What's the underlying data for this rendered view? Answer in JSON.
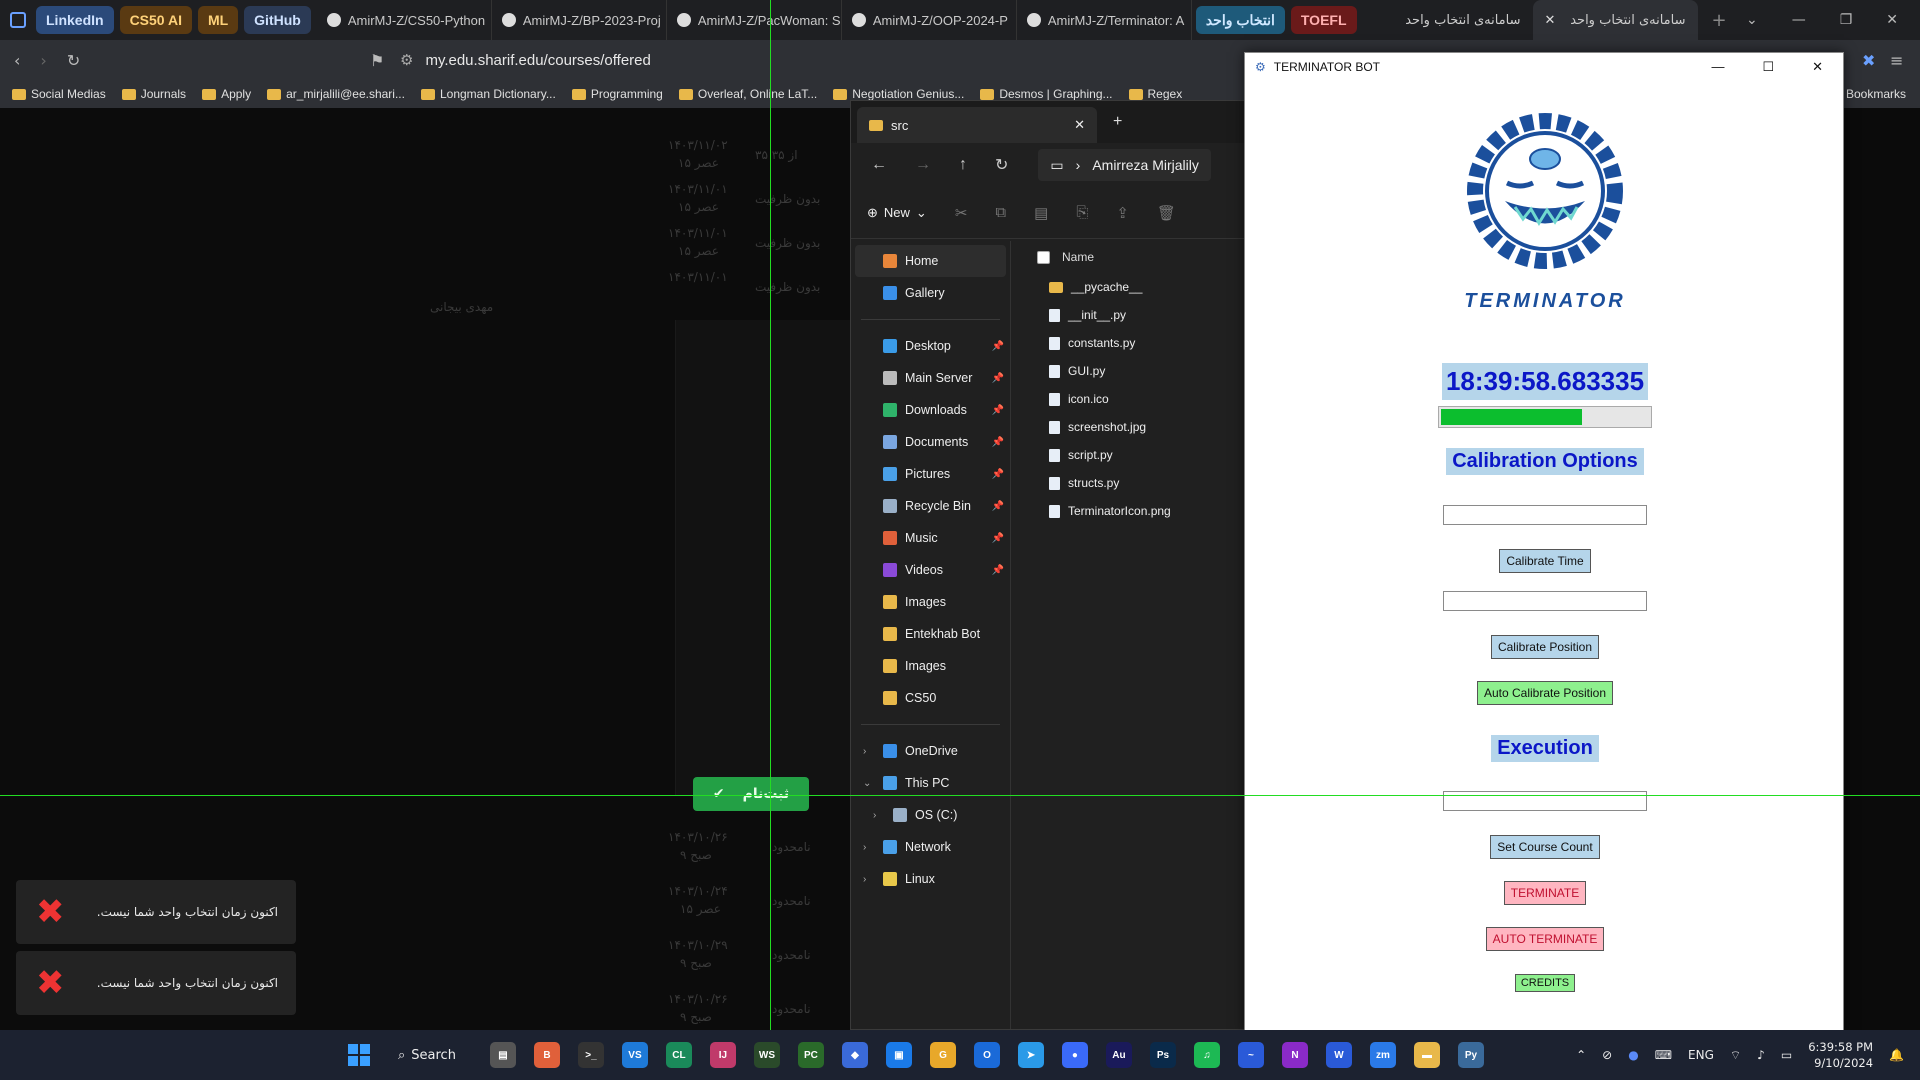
{
  "browser": {
    "pills": [
      {
        "label": "LinkedIn",
        "bg": "#2b4a7a",
        "fg": "#cfe2ff"
      },
      {
        "label": "CS50 AI",
        "bg": "#5a3a12",
        "fg": "#ffd27a"
      },
      {
        "label": "ML",
        "bg": "#5a3a12",
        "fg": "#ffd27a"
      },
      {
        "label": "GitHub",
        "bg": "#2b3a55",
        "fg": "#cfe2ff"
      }
    ],
    "gh_tabs": [
      "AmirMJ-Z/CS50-Python",
      "AmirMJ-Z/BP-2023-Proj",
      "AmirMJ-Z/PacWoman: S",
      "AmirMJ-Z/OOP-2024-P",
      "AmirMJ-Z/Terminator: A"
    ],
    "pill_select": "انتخاب واحد",
    "pill_toefl": "TOEFL",
    "tab_inactive": "سامانه‌ی انتخاب واحد",
    "tab_active": "سامانه‌ی انتخاب واحد",
    "url": "my.edu.sharif.edu/courses/offered",
    "bookmarks": [
      "Social Medias",
      "Journals",
      "Apply",
      "ar_mirjalili@ee.shari...",
      "Longman Dictionary...",
      "Programming",
      "Overleaf, Online LaT...",
      "Negotiation Genius...",
      "Desmos | Graphing...",
      "Regex"
    ],
    "all_bookmarks": "Bookmarks"
  },
  "page": {
    "rows": [
      {
        "date": "۱۴۰۳/۱۱/۰۲",
        "time": "۱۵ عصر",
        "cap": "۳۵ از ۳۵"
      },
      {
        "date": "۱۴۰۳/۱۱/۰۱",
        "time": "۱۵ عصر",
        "cap": "بدون ظرفیت"
      },
      {
        "date": "۱۴۰۳/۱۱/۰۱",
        "time": "۱۵ عصر",
        "cap": "بدون ظرفیت"
      },
      {
        "date": "۱۴۰۳/۱۱/۰۱",
        "time": "",
        "cap": "بدون ظرفیت"
      }
    ],
    "teacher": "مهدی بیجانی",
    "lower_rows": [
      {
        "date": "۱۴۰۳/۱۰/۲۶",
        "time": "۹ صبح",
        "cap": "نامحدود"
      },
      {
        "date": "۱۴۰۳/۱۰/۲۴",
        "time": "۱۵ عصر",
        "cap": "نامحدود"
      },
      {
        "date": "۱۴۰۳/۱۰/۲۹",
        "time": "۹ صبح",
        "cap": "نامحدود"
      },
      {
        "date": "۱۴۰۳/۱۰/۲۶",
        "time": "۹ صبح",
        "cap": "نامحدود"
      }
    ],
    "register_label": "ثبت‌نام",
    "toasts": [
      "اکنون زمان انتخاب واحد شما نیست.",
      "اکنون زمان انتخاب واحد شما نیست."
    ]
  },
  "explorer": {
    "tab_title": "src",
    "crumb": "Amirreza Mirjalily",
    "new_label": "New",
    "column_name": "Name",
    "quick": [
      {
        "label": "Home",
        "color": "#e8863a",
        "sel": true
      },
      {
        "label": "Gallery",
        "color": "#3a8fe8"
      }
    ],
    "pinned": [
      {
        "label": "Desktop",
        "color": "#3a9be8"
      },
      {
        "label": "Main Server",
        "color": "#bbbbbb"
      },
      {
        "label": "Downloads",
        "color": "#2fb36a"
      },
      {
        "label": "Documents",
        "color": "#7aa6e0"
      },
      {
        "label": "Pictures",
        "color": "#4aa0e8"
      },
      {
        "label": "Recycle Bin",
        "color": "#9ab0c8"
      },
      {
        "label": "Music",
        "color": "#e0603a"
      },
      {
        "label": "Videos",
        "color": "#8a4ad8"
      },
      {
        "label": "Images",
        "color": "#e8b84a"
      },
      {
        "label": "Entekhab Bot",
        "color": "#e8b84a"
      },
      {
        "label": "Images",
        "color": "#e8b84a"
      },
      {
        "label": "CS50",
        "color": "#e8b84a"
      }
    ],
    "tree": [
      {
        "label": "OneDrive",
        "color": "#3a8fe8",
        "chev": "›",
        "indent": 0
      },
      {
        "label": "This PC",
        "color": "#4aa0e8",
        "chev": "⌄",
        "indent": 0
      },
      {
        "label": "OS (C:)",
        "color": "#9ab0c8",
        "chev": "›",
        "indent": 1
      },
      {
        "label": "Network",
        "color": "#4aa0e8",
        "chev": "›",
        "indent": 0
      },
      {
        "label": "Linux",
        "color": "#e8c84a",
        "chev": "›",
        "indent": 0
      }
    ],
    "files": [
      {
        "name": "__pycache__",
        "folder": true
      },
      {
        "name": "__init__.py"
      },
      {
        "name": "constants.py"
      },
      {
        "name": "GUI.py"
      },
      {
        "name": "icon.ico"
      },
      {
        "name": "screenshot.jpg"
      },
      {
        "name": "script.py"
      },
      {
        "name": "structs.py"
      },
      {
        "name": "TerminatorIcon.png"
      }
    ]
  },
  "bot": {
    "title": "TERMINATOR BOT",
    "logo_text": "TERMINATOR",
    "clock": "18:39:58.683335",
    "progress": 0.67,
    "calibration_heading": "Calibration Options",
    "calibrate_time": "Calibrate Time",
    "calibrate_position": "Calibrate Position",
    "auto_calibrate": "Auto Calibrate Position",
    "execution_heading": "Execution",
    "set_course_count": "Set Course Count",
    "terminate": "TERMINATE",
    "auto_terminate": "AUTO TERMINATE",
    "credits": "CREDITS"
  },
  "taskbar": {
    "search": "Search",
    "apps": [
      {
        "t": "▤",
        "bg": "#555"
      },
      {
        "t": "B",
        "bg": "#e0603a"
      },
      {
        "t": ">_",
        "bg": "#333"
      },
      {
        "t": "VS",
        "bg": "#1e7ad8"
      },
      {
        "t": "CL",
        "bg": "#1a8a5a"
      },
      {
        "t": "IJ",
        "bg": "#c03a6a"
      },
      {
        "t": "WS",
        "bg": "#2a4a2a"
      },
      {
        "t": "PC",
        "bg": "#2a6a2a"
      },
      {
        "t": "◆",
        "bg": "#3a6ad8"
      },
      {
        "t": "▣",
        "bg": "#1a7ae8"
      },
      {
        "t": "G",
        "bg": "#e8a82a"
      },
      {
        "t": "O",
        "bg": "#1a6ad8"
      },
      {
        "t": "➤",
        "bg": "#2a9ae8"
      },
      {
        "t": "●",
        "bg": "#3a6af8"
      },
      {
        "t": "Au",
        "bg": "#1a1a5a"
      },
      {
        "t": "Ps",
        "bg": "#0a2a4a"
      },
      {
        "t": "♫",
        "bg": "#1db954"
      },
      {
        "t": "~",
        "bg": "#2a5ad8"
      },
      {
        "t": "N",
        "bg": "#8a2ac8"
      },
      {
        "t": "W",
        "bg": "#2a5ad8"
      },
      {
        "t": "zm",
        "bg": "#2a7ae8"
      },
      {
        "t": "▬",
        "bg": "#e8b84a"
      },
      {
        "t": "Py",
        "bg": "#3a6a9a"
      }
    ],
    "lang": "ENG",
    "time": "6:39:58 PM",
    "date": "9/10/2024"
  }
}
